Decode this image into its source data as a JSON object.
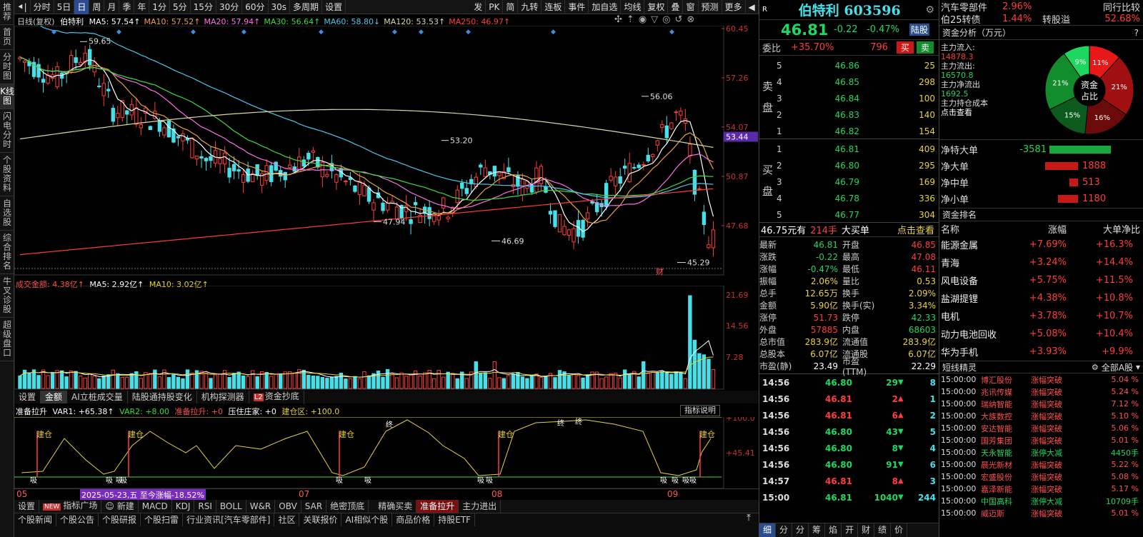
{
  "leftnav": [
    "推荐",
    "首页",
    "分时图",
    "K线图",
    "闪电分时",
    "个股资料",
    "自选股",
    "综合排名",
    "牛叉诊股",
    "超级盘口"
  ],
  "toolbar": {
    "items": [
      "分时",
      "5日",
      "日",
      "周",
      "月",
      "季",
      "年",
      "1分",
      "5分",
      "15分",
      "30分",
      "60分",
      "30s",
      "多周期",
      "设置"
    ],
    "right_items": [
      "发",
      "PK",
      "简",
      "九转",
      "连板",
      "事件",
      "加自选",
      "均线",
      "复权",
      "叠",
      "窗",
      "预测",
      "更多"
    ]
  },
  "chart": {
    "period_label": "日线(复权)",
    "stock_name": "伯特利",
    "ma": [
      {
        "label": "MA5: 57.54↑",
        "color": "#ffffff"
      },
      {
        "label": "MA10: 57.52↑",
        "color": "#e8a23c"
      },
      {
        "label": "MA20: 57.94↑",
        "color": "#ff6ee8"
      },
      {
        "label": "MA30: 56.64↑",
        "color": "#3cdc3c"
      },
      {
        "label": "MA60: 58.80↓",
        "color": "#48c8e8"
      },
      {
        "label": "MA120: 53.53↑",
        "color": "#d8d8a0"
      },
      {
        "label": "MA250: 46.97↑",
        "color": "#ff3c3c"
      }
    ],
    "price_axis": [
      "60.45",
      "57.26",
      "54.07",
      "50.87",
      "47.68"
    ],
    "current_price_tag": "53.44",
    "annotations": {
      "high1": "59.65",
      "high2": "56.06",
      "mid": "53.20",
      "low1": "47.94",
      "low2": "46.69",
      "low3": "45.29",
      "cai": "财"
    },
    "date_axis": [
      "05",
      "07",
      "08",
      "09"
    ],
    "highlight_date": "2025-05-23,五 至今涨幅-18.52%"
  },
  "volume": {
    "label": "成交金额: 4.38亿↑",
    "ma5": "MA5: 2.92亿↑",
    "ma10": "MA10: 3.02亿↑",
    "axis": [
      "21.69",
      "14.56",
      "7.28"
    ],
    "tabs": [
      "设置",
      "金额",
      "AI立桩成交量",
      "陆股通持股变化",
      "机构探测器",
      "资金抄底"
    ],
    "l2": "L2"
  },
  "indicator": {
    "title": "准备拉升",
    "var1": "VAR1: +65.38↑",
    "var2": "VAR2: +8.00",
    "lash": "准备拉升: +0",
    "press": "压住庄家: +0",
    "build": "建仓区: +100.0",
    "desc_btn": "指标说明",
    "axis": [
      "+100.0",
      "+45.41"
    ],
    "build_label": "建仓",
    "suck_label": "吸",
    "end_label": "终"
  },
  "bottom_tabs": [
    "设置",
    "指标广场",
    "新建",
    "MACD",
    "KDJ",
    "RSI",
    "BOLL",
    "W&R",
    "OBV",
    "SAR",
    "绝密顶底",
    "精确买卖",
    "准备拉升",
    "主力进出"
  ],
  "new_badge": "NEW",
  "status_bar": [
    "个股新闻",
    "个股公告",
    "个股研报",
    "个股扫雷",
    "行业资讯[汽车零部件]",
    "社区",
    "关联报价",
    "AI相似个股",
    "商品价格",
    "持股ETF"
  ],
  "quote": {
    "name": "伯特利 603596",
    "price": "46.81",
    "change": "-0.22",
    "pct": "-0.47%",
    "tag": "陆股",
    "wbi_label": "委比",
    "wbi": "+35.70%",
    "wbi_vol": "796",
    "buy_btn": "买",
    "sell_btn": "卖",
    "sell_side": "卖盘",
    "buy_side": "买盘",
    "asks": [
      {
        "lv": "5",
        "p": "46.86",
        "v": "25"
      },
      {
        "lv": "4",
        "p": "46.85",
        "v": "298"
      },
      {
        "lv": "3",
        "p": "46.84",
        "v": "100"
      },
      {
        "lv": "2",
        "p": "46.83",
        "v": "140"
      },
      {
        "lv": "1",
        "p": "46.82",
        "v": "154"
      }
    ],
    "bids": [
      {
        "lv": "1",
        "p": "46.81",
        "v": "409"
      },
      {
        "lv": "2",
        "p": "46.80",
        "v": "295"
      },
      {
        "lv": "3",
        "p": "46.79",
        "v": "169"
      },
      {
        "lv": "4",
        "p": "46.78",
        "v": "336"
      },
      {
        "lv": "5",
        "p": "46.77",
        "v": "304"
      }
    ],
    "big_order": {
      "p": "46.75元有",
      "v": "214手",
      "t": "大买单",
      "link": "点击查看"
    },
    "stats": [
      [
        "最新",
        "46.81",
        "开盘",
        "46.85"
      ],
      [
        "涨跌",
        "-0.22",
        "最高",
        "47.08"
      ],
      [
        "涨幅",
        "-0.47%",
        "最低",
        "46.11"
      ],
      [
        "振幅",
        "2.06%",
        "量比",
        "0.53"
      ],
      [
        "总手",
        "12.65万",
        "换手",
        "2.09%"
      ],
      [
        "金额",
        "5.90亿",
        "换手(实)",
        "3.34%"
      ],
      [
        "涨停",
        "51.73",
        "跌停",
        "42.33"
      ],
      [
        "外盘",
        "57885",
        "内盘",
        "68603"
      ],
      [
        "总市值",
        "283.9亿",
        "流通值",
        "283.9亿"
      ],
      [
        "总股本",
        "6.07亿",
        "流通股",
        "6.07亿"
      ],
      [
        "市盈(静)",
        "23.49",
        "市盈(TTM)",
        "22.29"
      ]
    ],
    "ticks": [
      {
        "t": "14:56",
        "p": "46.80",
        "v": "29",
        "d": "down",
        "n": "8"
      },
      {
        "t": "14:56",
        "p": "46.81",
        "v": "2",
        "d": "up",
        "n": "1"
      },
      {
        "t": "14:56",
        "p": "46.81",
        "v": "6",
        "d": "up",
        "n": "2"
      },
      {
        "t": "14:56",
        "p": "46.80",
        "v": "43",
        "d": "down",
        "n": "5"
      },
      {
        "t": "14:56",
        "p": "46.80",
        "v": "8",
        "d": "down",
        "n": "4"
      },
      {
        "t": "14:56",
        "p": "46.80",
        "v": "91",
        "d": "down",
        "n": "6"
      },
      {
        "t": "14:57",
        "p": "46.81",
        "v": "8",
        "d": "up",
        "n": "3"
      },
      {
        "t": "15:00",
        "p": "46.81",
        "v": "1040",
        "d": "down",
        "n": "244"
      }
    ],
    "bottom_tabs": [
      "细",
      "分",
      "分",
      "筹",
      "焰",
      "开",
      "财",
      "绩",
      "价"
    ]
  },
  "sector": {
    "industry": "汽车零部件",
    "industry_pct": "2.96%",
    "industry_link": "同行比较",
    "bond": "伯25转债",
    "bond_pct": "1.44%",
    "bond_label": "转股溢",
    "bond_premium": "52.68%",
    "fund_title": "资金分析（万元）",
    "help": "?",
    "main_in_label": "主力流入:",
    "main_in": "14878.3",
    "main_out_label": "主力流出:",
    "main_out": "16570.8",
    "main_net_label": "主力净流出",
    "main_net": "1692.5",
    "main_cost_label": "主力持仓成本",
    "main_cost_link": "点击查看",
    "pie_center": [
      "资金",
      "占比"
    ],
    "pie": [
      {
        "label": "11%",
        "value": 11,
        "color": "#e81818"
      },
      {
        "label": "21%",
        "value": 21,
        "color": "#a01010"
      },
      {
        "label": "16%",
        "value": 16,
        "color": "#6a0a0a"
      },
      {
        "label": "15%",
        "value": 15,
        "color": "#0c5a1e"
      },
      {
        "label": "21%",
        "value": 21,
        "color": "#128c2c"
      },
      {
        "label": "9%",
        "value": 9,
        "color": "#1ed760"
      }
    ],
    "flows": [
      {
        "label": "净特大单",
        "value": "-3581",
        "dir": "down",
        "ratio": 1.0
      },
      {
        "label": "净大单",
        "value": "1888",
        "dir": "up",
        "ratio": 0.53
      },
      {
        "label": "净中单",
        "value": "513",
        "dir": "up",
        "ratio": 0.14
      },
      {
        "label": "净小单",
        "value": "1180",
        "dir": "up",
        "ratio": 0.33
      }
    ],
    "rank_title": "资金排名",
    "rank_headers": [
      "名称",
      "涨幅",
      "大单净比"
    ],
    "rank": [
      [
        "能源金属",
        "+7.69%",
        "+16.3%"
      ],
      [
        "青海",
        "+3.24%",
        "+14.4%"
      ],
      [
        "风电设备",
        "+5.75%",
        "+11.5%"
      ],
      [
        "盐湖提锂",
        "+4.38%",
        "+10.8%"
      ],
      [
        "电机",
        "+3.78%",
        "+10.7%"
      ],
      [
        "动力电池回收",
        "+5.08%",
        "+10.4%"
      ],
      [
        "华为手机",
        "+3.93%",
        "+9.9%"
      ]
    ],
    "news_title": "短线精灵",
    "news_filter": "全部A股",
    "news": [
      [
        "15:00:00",
        "博汇股份",
        "涨幅突破",
        "5.04 %"
      ],
      [
        "15:00:00",
        "兆讯传媒",
        "涨幅突破",
        "5.24 %"
      ],
      [
        "15:00:00",
        "瑞纳智能",
        "涨幅突破",
        "7.12 %"
      ],
      [
        "15:00:00",
        "大族数控",
        "涨幅突破",
        "5.10 %"
      ],
      [
        "15:00:00",
        "安达智能",
        "涨幅突破",
        "5.06 %"
      ],
      [
        "15:00:00",
        "国芳集团",
        "涨幅突破",
        "5.01 %"
      ],
      [
        "15:00:00",
        "天永智能",
        "涨停大减",
        "4450手"
      ],
      [
        "15:00:00",
        "晨光新材",
        "涨幅突破",
        "5.22 %"
      ],
      [
        "15:00:00",
        "宏盛股份",
        "涨幅突破",
        "5.08 %"
      ],
      [
        "15:00:00",
        "嘉泽新能",
        "涨幅突破",
        "5.17 %"
      ],
      [
        "15:00:00",
        "中国高科",
        "涨停大减",
        "10709手"
      ],
      [
        "15:00:00",
        "威迈斯",
        "涨幅突破",
        "5.01 %"
      ]
    ]
  }
}
